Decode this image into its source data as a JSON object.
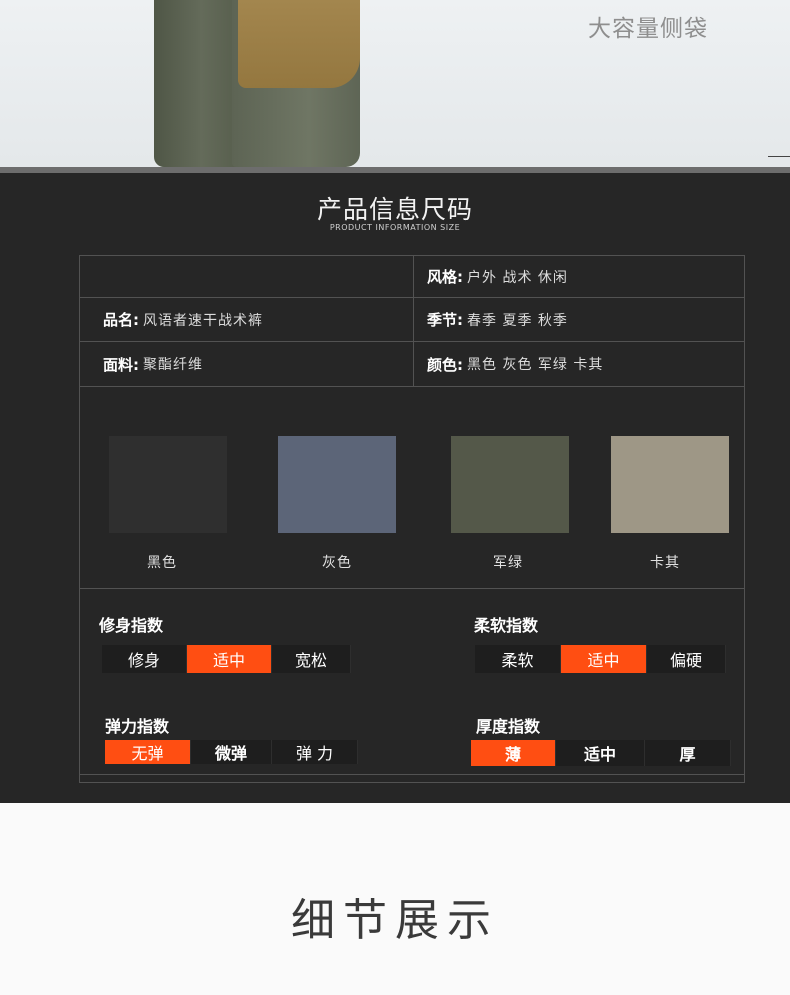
{
  "hero": {
    "caption": "大容量侧袋"
  },
  "section": {
    "title": "产品信息尺码",
    "subtitle": "PRODUCT INFORMATION SIZE"
  },
  "info": {
    "style": {
      "label": "风格:",
      "value": "户外   战术   休闲"
    },
    "name": {
      "label": "品名:",
      "value": "风语者速干战术裤"
    },
    "season": {
      "label": "季节:",
      "value": "春季    夏季    秋季"
    },
    "fabric": {
      "label": "面料:",
      "value": "聚酯纤维"
    },
    "color": {
      "label": "颜色:",
      "value": "黑色   灰色   军绿   卡其"
    }
  },
  "swatches": [
    {
      "name": "黑色",
      "color": "#2f2f2f"
    },
    {
      "name": "灰色",
      "color": "#5c6578"
    },
    {
      "name": "军绿",
      "color": "#545849"
    },
    {
      "name": "卡其",
      "color": "#9e9786"
    }
  ],
  "indices": {
    "fit": {
      "title": "修身指数",
      "options": [
        "修身",
        "适中",
        "宽松"
      ],
      "selected": "适中"
    },
    "softness": {
      "title": "柔软指数",
      "options": [
        "柔软",
        "适中",
        "偏硬"
      ],
      "selected": "适中"
    },
    "elasticity": {
      "title": "弹力指数",
      "options": [
        "无弹",
        "微弹",
        "弹 力"
      ],
      "selected": "无弹"
    },
    "thickness": {
      "title": "厚度指数",
      "options": [
        "薄",
        "适中",
        "厚"
      ],
      "selected": "薄"
    }
  },
  "highlight_color": "#ff4e12",
  "details": {
    "title": "细节展示"
  }
}
